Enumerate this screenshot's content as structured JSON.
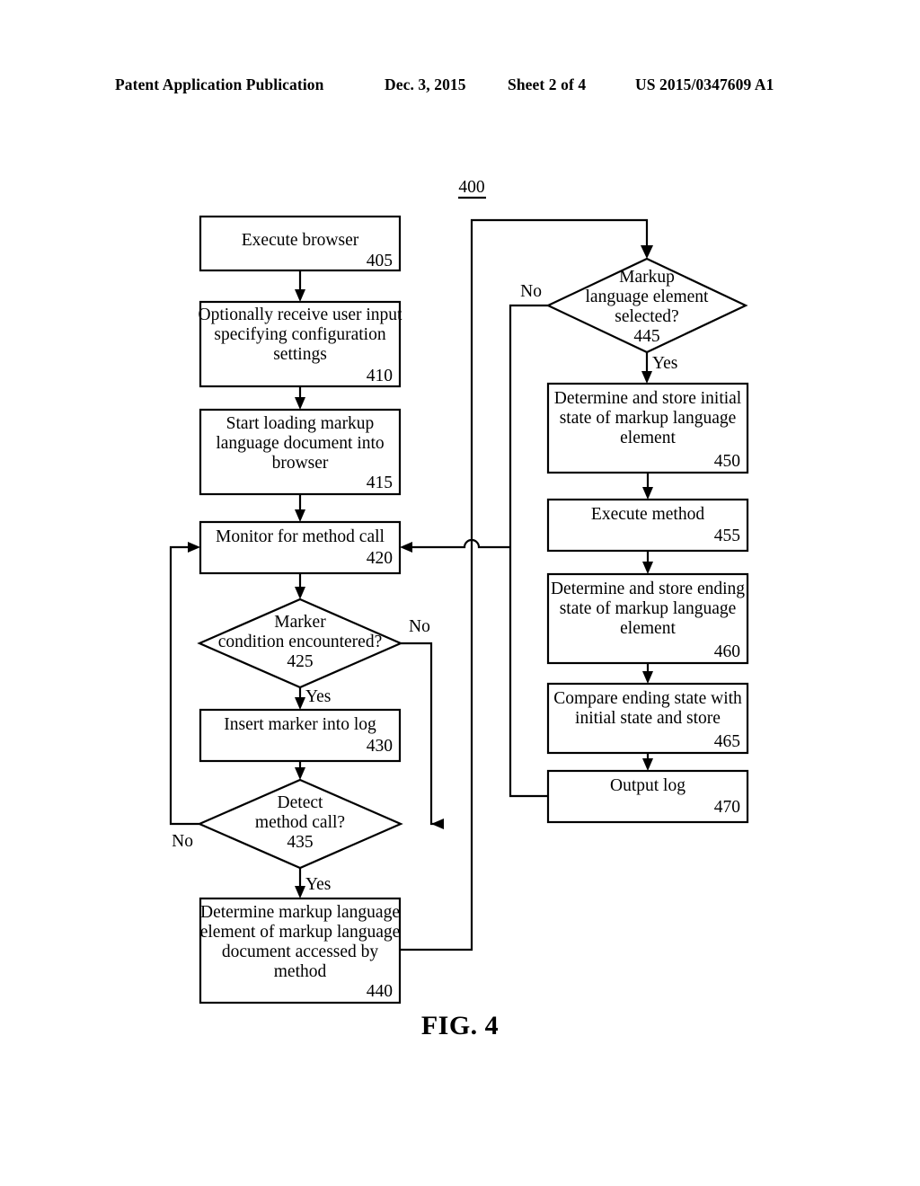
{
  "header": {
    "publication": "Patent Application Publication",
    "date": "Dec. 3, 2015",
    "sheet": "Sheet 2 of 4",
    "number": "US 2015/0347609 A1"
  },
  "figure": {
    "caption": "FIG. 4",
    "diagram_ref": "400"
  },
  "colors": {
    "ink": "#000000",
    "paper": "#ffffff"
  },
  "flowchart": {
    "nodes": [
      {
        "id": "n405",
        "shape": "box",
        "ref": "405",
        "lines": [
          "Execute browser"
        ]
      },
      {
        "id": "n410",
        "shape": "box",
        "ref": "410",
        "lines": [
          "Optionally receive user input",
          "specifying configuration",
          "settings"
        ]
      },
      {
        "id": "n415",
        "shape": "box",
        "ref": "415",
        "lines": [
          "Start loading markup",
          "language document into",
          "browser"
        ]
      },
      {
        "id": "n420",
        "shape": "box",
        "ref": "420",
        "lines": [
          "Monitor for method call"
        ]
      },
      {
        "id": "n425",
        "shape": "diamond",
        "ref": "425",
        "lines": [
          "Marker",
          "condition encountered?"
        ]
      },
      {
        "id": "n430",
        "shape": "box",
        "ref": "430",
        "lines": [
          "Insert marker into log"
        ]
      },
      {
        "id": "n435",
        "shape": "diamond",
        "ref": "435",
        "lines": [
          "Detect",
          "method call?"
        ]
      },
      {
        "id": "n440",
        "shape": "box",
        "ref": "440",
        "lines": [
          "Determine markup language",
          "element of markup language",
          "document accessed by",
          "method"
        ]
      },
      {
        "id": "n445",
        "shape": "diamond",
        "ref": "445",
        "lines": [
          "Markup",
          "language element",
          "selected?"
        ]
      },
      {
        "id": "n450",
        "shape": "box",
        "ref": "450",
        "lines": [
          "Determine and store initial",
          "state of markup language",
          "element"
        ]
      },
      {
        "id": "n455",
        "shape": "box",
        "ref": "455",
        "lines": [
          "Execute method"
        ]
      },
      {
        "id": "n460",
        "shape": "box",
        "ref": "460",
        "lines": [
          "Determine and store ending",
          "state of markup language",
          "element"
        ]
      },
      {
        "id": "n465",
        "shape": "box",
        "ref": "465",
        "lines": [
          "Compare ending state with",
          "initial state and store"
        ]
      },
      {
        "id": "n470",
        "shape": "box",
        "ref": "470",
        "lines": [
          "Output log"
        ]
      }
    ],
    "branch_labels": [
      {
        "id": "b425no",
        "text": "No",
        "from": "425"
      },
      {
        "id": "b425yes",
        "text": "Yes",
        "from": "425"
      },
      {
        "id": "b435no",
        "text": "No",
        "from": "435"
      },
      {
        "id": "b435yes",
        "text": "Yes",
        "from": "435"
      },
      {
        "id": "b445no",
        "text": "No",
        "from": "445"
      },
      {
        "id": "b445yes",
        "text": "Yes",
        "from": "445"
      }
    ]
  }
}
